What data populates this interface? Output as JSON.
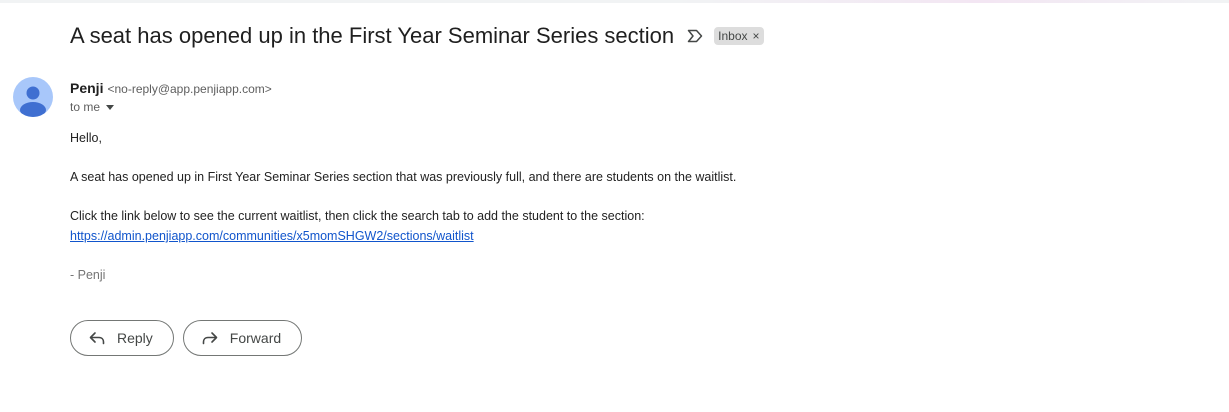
{
  "email": {
    "subject": "A seat has opened up in the First Year Seminar Series section",
    "label": "Inbox",
    "label_remove": "×",
    "sender_name": "Penji",
    "sender_email": "<no-reply@app.penjiapp.com>",
    "recipient": "to me",
    "body": {
      "greeting": "Hello,",
      "paragraph1": "A seat has opened up in First Year Seminar Series section that was previously full, and there are students on the waitlist.",
      "paragraph2": "Click the link below to see the current waitlist, then click the search tab to add the student to the section:",
      "link": "https://admin.penjiapp.com/communities/x5momSHGW2/sections/waitlist",
      "signature": "- Penji"
    }
  },
  "actions": {
    "reply_label": "Reply",
    "forward_label": "Forward"
  },
  "icons": [
    "important-marker-icon",
    "avatar-person-icon",
    "reply-icon",
    "forward-icon",
    "dropdown-caret-icon"
  ]
}
